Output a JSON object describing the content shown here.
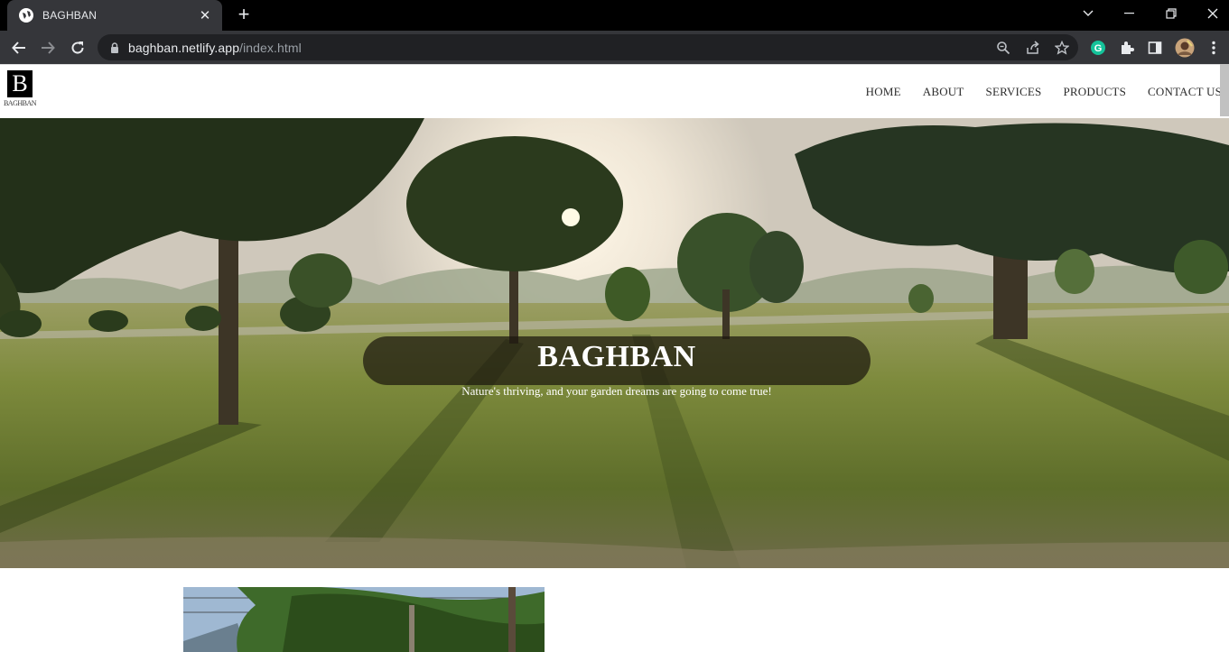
{
  "browser": {
    "tab_title": "BAGHBAN",
    "url_domain": "baghban.netlify.app",
    "url_path": "/index.html",
    "icons": [
      "globe-icon",
      "close-icon",
      "plus-icon",
      "chevron-down-icon",
      "minimize-icon",
      "restore-icon",
      "window-close-icon",
      "back-icon",
      "forward-icon",
      "reload-icon",
      "lock-icon",
      "zoom-icon",
      "share-icon",
      "star-icon",
      "grammarly-icon",
      "extensions-icon",
      "side-panel-icon",
      "profile-avatar",
      "menu-icon"
    ]
  },
  "site": {
    "logo_letter": "B",
    "logo_word": "BAGHBAN",
    "nav": [
      {
        "label": "HOME"
      },
      {
        "label": "ABOUT"
      },
      {
        "label": "SERVICES"
      },
      {
        "label": "PRODUCTS"
      },
      {
        "label": "CONTACT US"
      }
    ],
    "hero": {
      "title": "BAGHBAN",
      "subtitle": "Nature's thriving, and your garden dreams are going to come true!"
    }
  },
  "colors": {
    "chrome_bg": "#000000",
    "tab_active": "#35363a",
    "omnibox": "#202124",
    "hero_banner": "rgba(28,24,14,0.72)",
    "grammarly": "#15c39a"
  }
}
